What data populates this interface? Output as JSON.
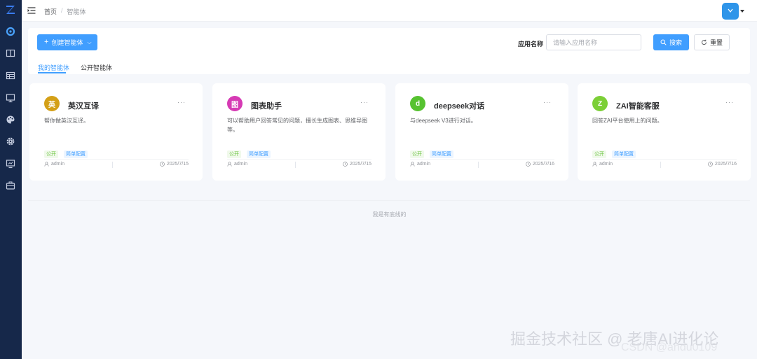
{
  "breadcrumb": {
    "home": "首页",
    "separator": "/",
    "current": "智能体"
  },
  "toolbar": {
    "create_label": "创建智能体",
    "filter_label": "应用名称",
    "search_placeholder": "请输入应用名称",
    "search_label": "搜索",
    "reset_label": "重置"
  },
  "tabs": {
    "mine": "我的智能体",
    "public": "公开智能体"
  },
  "cards": [
    {
      "avatar": "英",
      "avatar_color": "#d4a017",
      "name": "英汉互译",
      "desc": "帮你做英汉互译。",
      "tag_public": "公开",
      "tag_config": "简单配置",
      "author": "admin",
      "date": "2025/7/15"
    },
    {
      "avatar": "图",
      "avatar_color": "#d63ab4",
      "name": "图表助手",
      "desc": "可以帮助用户回答常见的问题，擅长生成图表、思维导图等。",
      "tag_public": "公开",
      "tag_config": "简单配置",
      "author": "admin",
      "date": "2025/7/15"
    },
    {
      "avatar": "d",
      "avatar_color": "#56c230",
      "name": "deepseek对话",
      "desc": "与deepseek V3进行对话。",
      "tag_public": "公开",
      "tag_config": "简单配置",
      "author": "admin",
      "date": "2025/7/16"
    },
    {
      "avatar": "Z",
      "avatar_color": "#7ccf37",
      "name": "ZAI智能客服",
      "desc": "回答ZAI平台使用上的问题。",
      "tag_public": "公开",
      "tag_config": "简单配置",
      "author": "admin",
      "date": "2025/7/16"
    }
  ],
  "card_more": "···",
  "end_text": "我是有底线的",
  "watermark": {
    "line1": "掘金技术社区 @ 老唐AI进化论",
    "line2": "CSDN @andu0109"
  },
  "colors": {
    "sidebar": "#16284a",
    "primary": "#409eff",
    "accent": "#2f95e9"
  },
  "icons": {
    "sidebar": [
      "logo-icon",
      "dashboard-icon",
      "book-icon",
      "table-icon",
      "monitor-icon",
      "palette-icon",
      "gear-icon",
      "screen-icon",
      "toolbox-icon"
    ],
    "header": [
      "menu-fold-icon",
      "user-avatar"
    ]
  }
}
